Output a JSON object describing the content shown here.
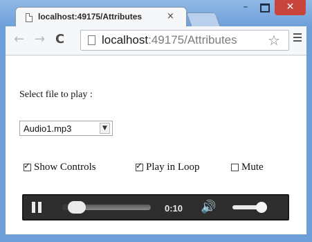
{
  "browser": {
    "tab_title": "localhost:49175/Attributes",
    "tab_close": "×",
    "window_controls": {
      "minimize": "–",
      "close": "✕"
    },
    "nav": {
      "back": "←",
      "forward": "→",
      "reload": "C"
    },
    "url_host": "localhost",
    "url_rest": ":49175/Attributes",
    "bookmark_star": "☆",
    "colors": {
      "frame": "#6fa0da",
      "close_button": "#c9443a"
    }
  },
  "page": {
    "select_label": "Select file to play :",
    "file_select": {
      "value": "Audio1.mp3",
      "arrow": "▼"
    },
    "checkboxes": [
      {
        "label": "Show Controls",
        "checked": true
      },
      {
        "label": "Play in Loop",
        "checked": true
      },
      {
        "label": "Mute",
        "checked": false
      }
    ],
    "player": {
      "state": "pause-icon",
      "time": "0:10",
      "seek_progress": 0.08,
      "volume_level": 1.0,
      "volume_icon": "🔊"
    }
  }
}
